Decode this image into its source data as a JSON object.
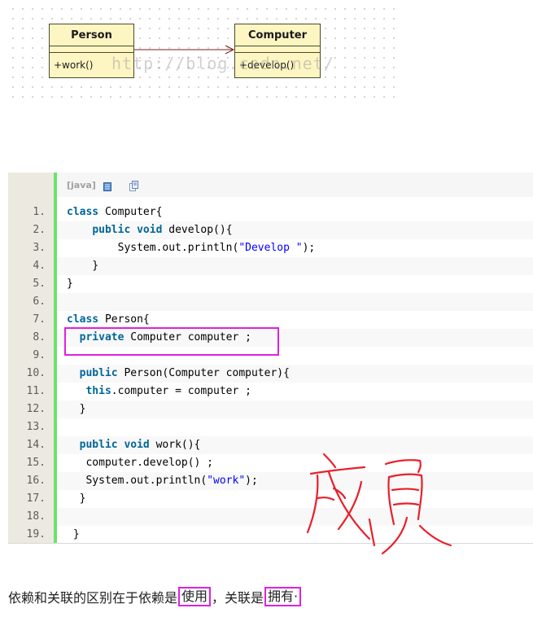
{
  "diagram": {
    "person_class": {
      "name": "Person",
      "operation": "+work()"
    },
    "computer_class": {
      "name": "Computer",
      "operation": "+develop()"
    },
    "watermark": "http://blog.csdn.net/"
  },
  "code": {
    "language_label": "[java]",
    "lines": [
      {
        "num": "1.",
        "parts": [
          [
            "kw",
            "class"
          ],
          [
            "",
            " Computer{"
          ]
        ]
      },
      {
        "num": "2.",
        "parts": [
          [
            "",
            "    "
          ],
          [
            "kw",
            "public"
          ],
          [
            "",
            " "
          ],
          [
            "kw",
            "void"
          ],
          [
            "",
            " develop(){"
          ]
        ]
      },
      {
        "num": "3.",
        "parts": [
          [
            "",
            "        System.out.println("
          ],
          [
            "str",
            "\"Develop \""
          ],
          [
            "",
            ");"
          ]
        ]
      },
      {
        "num": "4.",
        "parts": [
          [
            "",
            "    }"
          ]
        ]
      },
      {
        "num": "5.",
        "parts": [
          [
            "",
            "}"
          ]
        ]
      },
      {
        "num": "6.",
        "parts": []
      },
      {
        "num": "7.",
        "parts": [
          [
            "kw",
            "class"
          ],
          [
            "",
            " Person{"
          ]
        ]
      },
      {
        "num": "8.",
        "parts": [
          [
            "",
            "  "
          ],
          [
            "kw",
            "private"
          ],
          [
            "",
            " Computer computer ;"
          ]
        ]
      },
      {
        "num": "9.",
        "parts": []
      },
      {
        "num": "10.",
        "parts": [
          [
            "",
            "  "
          ],
          [
            "kw",
            "public"
          ],
          [
            "",
            " Person(Computer computer){"
          ]
        ]
      },
      {
        "num": "11.",
        "parts": [
          [
            "",
            "   "
          ],
          [
            "kw",
            "this"
          ],
          [
            "",
            ".computer = computer ;"
          ]
        ]
      },
      {
        "num": "12.",
        "parts": [
          [
            "",
            "  }"
          ]
        ]
      },
      {
        "num": "13.",
        "parts": []
      },
      {
        "num": "14.",
        "parts": [
          [
            "",
            "  "
          ],
          [
            "kw",
            "public"
          ],
          [
            "",
            " "
          ],
          [
            "kw",
            "void"
          ],
          [
            "",
            " work(){"
          ]
        ]
      },
      {
        "num": "15.",
        "parts": [
          [
            "",
            "   computer.develop() ;"
          ]
        ]
      },
      {
        "num": "16.",
        "parts": [
          [
            "",
            "   System.out.println("
          ],
          [
            "str",
            "\"work\""
          ],
          [
            "",
            ");"
          ]
        ]
      },
      {
        "num": "17.",
        "parts": [
          [
            "",
            "  }"
          ]
        ]
      },
      {
        "num": "18.",
        "parts": []
      },
      {
        "num": "19.",
        "parts": [
          [
            "",
            " }"
          ]
        ]
      }
    ]
  },
  "note": {
    "prefix": "依赖和关联的区别在于依赖是",
    "highlight1": "使用",
    "middle": "，关联是",
    "highlight2": "拥有·"
  },
  "colors": {
    "highlight_border": "#e020e0",
    "handwriting": "#e8202a",
    "keyword": "#006699",
    "string": "#0000ff",
    "uml_fill": "#fdf6c3",
    "gutter_bar": "#6ce26c"
  }
}
